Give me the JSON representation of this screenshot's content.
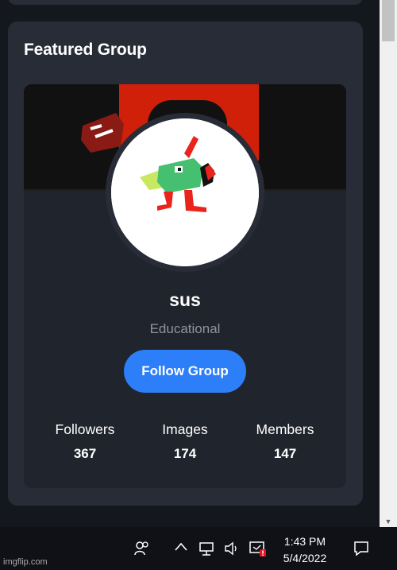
{
  "featured": {
    "title": "Featured Group",
    "group": {
      "name": "sus",
      "category": "Educational",
      "follow_label": "Follow Group"
    },
    "stats": [
      {
        "label": "Followers",
        "value": "367"
      },
      {
        "label": "Images",
        "value": "174"
      },
      {
        "label": "Members",
        "value": "147"
      }
    ]
  },
  "colors": {
    "page_bg": "#14171e",
    "card_bg": "#272c37",
    "inner_bg": "#20242d",
    "accent": "#2d7ff9",
    "muted_text": "#8f949c"
  },
  "taskbar": {
    "time": "1:43 PM",
    "date": "5/4/2022",
    "icons": [
      "people-icon",
      "chevron-up-icon",
      "network-icon",
      "volume-icon",
      "notification-badge-icon",
      "action-center-icon"
    ]
  },
  "watermark": "imgflip.com"
}
